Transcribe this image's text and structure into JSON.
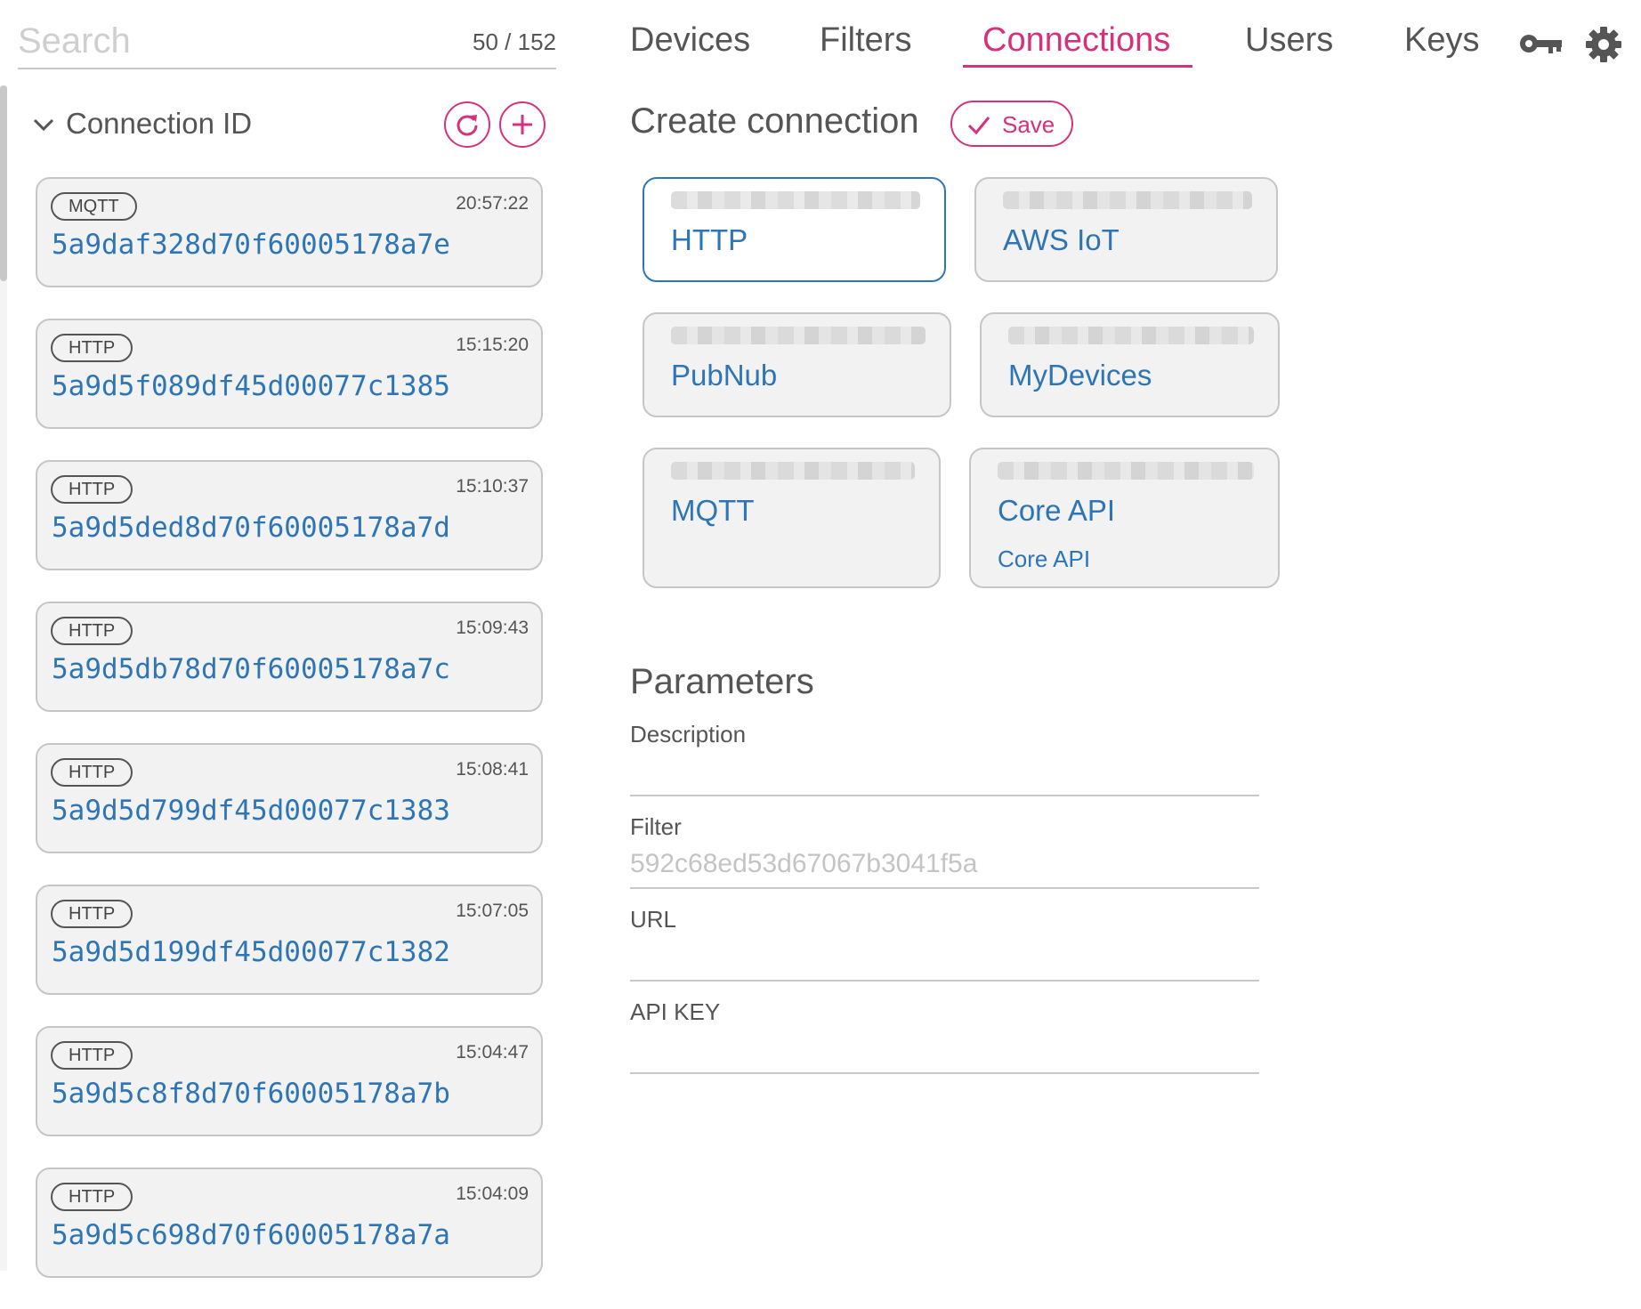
{
  "search": {
    "placeholder": "Search",
    "count": "50 / 152"
  },
  "nav": {
    "tabs": [
      "Devices",
      "Filters",
      "Connections",
      "Users",
      "Keys"
    ],
    "active_tab": "Connections"
  },
  "list": {
    "header": "Connection ID",
    "items": [
      {
        "type": "MQTT",
        "time": "20:57:22",
        "id": "5a9daf328d70f60005178a7e"
      },
      {
        "type": "HTTP",
        "time": "15:15:20",
        "id": "5a9d5f089df45d00077c1385"
      },
      {
        "type": "HTTP",
        "time": "15:10:37",
        "id": "5a9d5ded8d70f60005178a7d"
      },
      {
        "type": "HTTP",
        "time": "15:09:43",
        "id": "5a9d5db78d70f60005178a7c"
      },
      {
        "type": "HTTP",
        "time": "15:08:41",
        "id": "5a9d5d799df45d00077c1383"
      },
      {
        "type": "HTTP",
        "time": "15:07:05",
        "id": "5a9d5d199df45d00077c1382"
      },
      {
        "type": "HTTP",
        "time": "15:04:47",
        "id": "5a9d5c8f8d70f60005178a7b"
      },
      {
        "type": "HTTP",
        "time": "15:04:09",
        "id": "5a9d5c698d70f60005178a7a"
      }
    ]
  },
  "create": {
    "title": "Create connection",
    "save_label": "Save",
    "types": [
      {
        "name": "HTTP",
        "selected": true
      },
      {
        "name": "AWS IoT"
      },
      {
        "name": "PubNub"
      },
      {
        "name": "MyDevices"
      },
      {
        "name": "MQTT"
      },
      {
        "name": "Core API",
        "sub": "Core API"
      }
    ]
  },
  "parameters": {
    "title": "Parameters",
    "fields": [
      {
        "label": "Description",
        "value": ""
      },
      {
        "label": "Filter",
        "value": "592c68ed53d67067b3041f5a"
      },
      {
        "label": "URL",
        "value": ""
      },
      {
        "label": "API KEY",
        "value": ""
      }
    ]
  },
  "colors": {
    "accent": "#d6317c",
    "link": "#2e75b6",
    "card_bg": "#f2f2f2"
  }
}
